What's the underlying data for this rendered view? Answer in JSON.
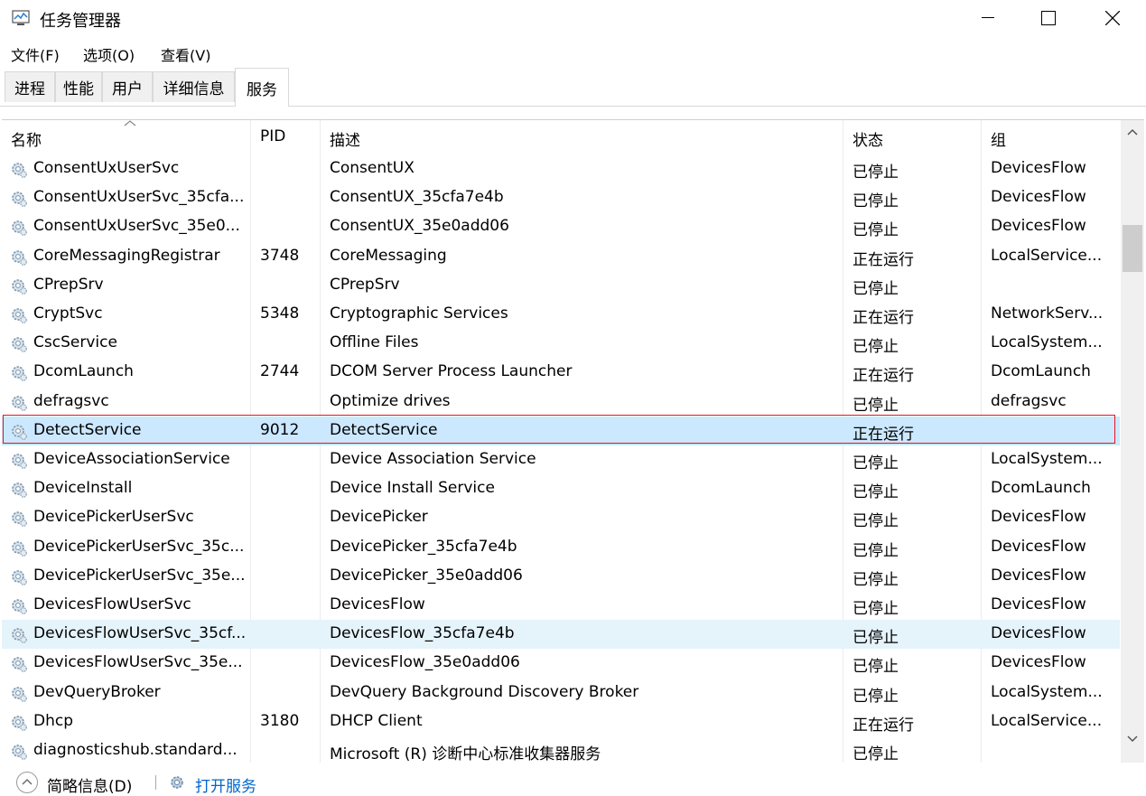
{
  "window": {
    "title": "任务管理器"
  },
  "menu": [
    "文件(F)",
    "选项(O)",
    "查看(V)"
  ],
  "tabs": [
    "进程",
    "性能",
    "用户",
    "详细信息",
    "服务"
  ],
  "active_tab": "服务",
  "columns": {
    "name": "名称",
    "pid": "PID",
    "desc": "描述",
    "status": "状态",
    "group": "组"
  },
  "rows": [
    {
      "name": "ConsentUxUserSvc",
      "pid": "",
      "desc": "ConsentUX",
      "status": "已停止",
      "group": "DevicesFlow"
    },
    {
      "name": "ConsentUxUserSvc_35cfa...",
      "pid": "",
      "desc": "ConsentUX_35cfa7e4b",
      "status": "已停止",
      "group": "DevicesFlow"
    },
    {
      "name": "ConsentUxUserSvc_35e0...",
      "pid": "",
      "desc": "ConsentUX_35e0add06",
      "status": "已停止",
      "group": "DevicesFlow"
    },
    {
      "name": "CoreMessagingRegistrar",
      "pid": "3748",
      "desc": "CoreMessaging",
      "status": "正在运行",
      "group": "LocalService..."
    },
    {
      "name": "CPrepSrv",
      "pid": "",
      "desc": "CPrepSrv",
      "status": "已停止",
      "group": ""
    },
    {
      "name": "CryptSvc",
      "pid": "5348",
      "desc": "Cryptographic Services",
      "status": "正在运行",
      "group": "NetworkServ..."
    },
    {
      "name": "CscService",
      "pid": "",
      "desc": "Offline Files",
      "status": "已停止",
      "group": "LocalSystem..."
    },
    {
      "name": "DcomLaunch",
      "pid": "2744",
      "desc": "DCOM Server Process Launcher",
      "status": "正在运行",
      "group": "DcomLaunch"
    },
    {
      "name": "defragsvc",
      "pid": "",
      "desc": "Optimize drives",
      "status": "已停止",
      "group": "defragsvc"
    },
    {
      "name": "DetectService",
      "pid": "9012",
      "desc": "DetectService",
      "status": "正在运行",
      "group": ""
    },
    {
      "name": "DeviceAssociationService",
      "pid": "",
      "desc": "Device Association Service",
      "status": "已停止",
      "group": "LocalSystem..."
    },
    {
      "name": "DeviceInstall",
      "pid": "",
      "desc": "Device Install Service",
      "status": "已停止",
      "group": "DcomLaunch"
    },
    {
      "name": "DevicePickerUserSvc",
      "pid": "",
      "desc": "DevicePicker",
      "status": "已停止",
      "group": "DevicesFlow"
    },
    {
      "name": "DevicePickerUserSvc_35c...",
      "pid": "",
      "desc": "DevicePicker_35cfa7e4b",
      "status": "已停止",
      "group": "DevicesFlow"
    },
    {
      "name": "DevicePickerUserSvc_35e...",
      "pid": "",
      "desc": "DevicePicker_35e0add06",
      "status": "已停止",
      "group": "DevicesFlow"
    },
    {
      "name": "DevicesFlowUserSvc",
      "pid": "",
      "desc": "DevicesFlow",
      "status": "已停止",
      "group": "DevicesFlow"
    },
    {
      "name": "DevicesFlowUserSvc_35cf...",
      "pid": "",
      "desc": "DevicesFlow_35cfa7e4b",
      "status": "已停止",
      "group": "DevicesFlow"
    },
    {
      "name": "DevicesFlowUserSvc_35e...",
      "pid": "",
      "desc": "DevicesFlow_35e0add06",
      "status": "已停止",
      "group": "DevicesFlow"
    },
    {
      "name": "DevQueryBroker",
      "pid": "",
      "desc": "DevQuery Background Discovery Broker",
      "status": "已停止",
      "group": "LocalSystem..."
    },
    {
      "name": "Dhcp",
      "pid": "3180",
      "desc": "DHCP Client",
      "status": "正在运行",
      "group": "LocalService..."
    },
    {
      "name": "diagnosticshub.standard...",
      "pid": "",
      "desc": "Microsoft (R) 诊断中心标准收集器服务",
      "status": "已停止",
      "group": ""
    }
  ],
  "selected_row": "DetectService",
  "hover_row": "DevicesFlowUserSvc_35cf...",
  "footer": {
    "details_label": "简略信息(D)",
    "open_services_label": "打开服务"
  }
}
